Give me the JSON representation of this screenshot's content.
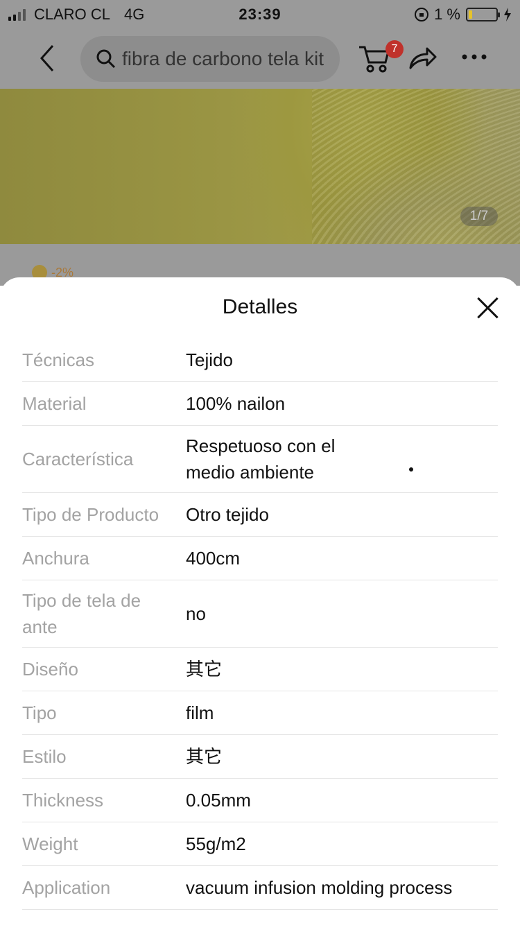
{
  "status": {
    "carrier": "CLARO CL",
    "network": "4G",
    "time": "23:39",
    "battery_text": "1 %"
  },
  "nav": {
    "search_query": "fibra de carbono tela kit",
    "cart_count": "7"
  },
  "product": {
    "image_counter": "1/7",
    "discount": "-2%"
  },
  "sheet": {
    "title": "Detalles",
    "rows": [
      {
        "label": "Técnicas",
        "value": "Tejido"
      },
      {
        "label": "Material",
        "value": "100% nailon"
      },
      {
        "label": "Característica",
        "value": "Respetuoso con el medio ambiente"
      },
      {
        "label": "Tipo de Producto",
        "value": "Otro tejido"
      },
      {
        "label": "Anchura",
        "value": "400cm"
      },
      {
        "label": "Tipo de tela de ante",
        "value": "no"
      },
      {
        "label": "Diseño",
        "value": "其它"
      },
      {
        "label": "Tipo",
        "value": "film"
      },
      {
        "label": "Estilo",
        "value": "其它"
      },
      {
        "label": "Thickness",
        "value": "0.05mm"
      },
      {
        "label": "Weight",
        "value": "55g/m2"
      },
      {
        "label": "Application",
        "value": "vacuum infusion molding process"
      }
    ]
  },
  "icons": [
    "signal-icon",
    "rotation-lock-icon",
    "battery-icon",
    "back-icon",
    "search-icon",
    "cart-icon",
    "share-icon",
    "more-icon",
    "close-icon",
    "coin-icon"
  ],
  "colors": {
    "badge": "#c0312b",
    "battery_low": "#e6c32b",
    "label_gray": "#a3a3a3"
  }
}
